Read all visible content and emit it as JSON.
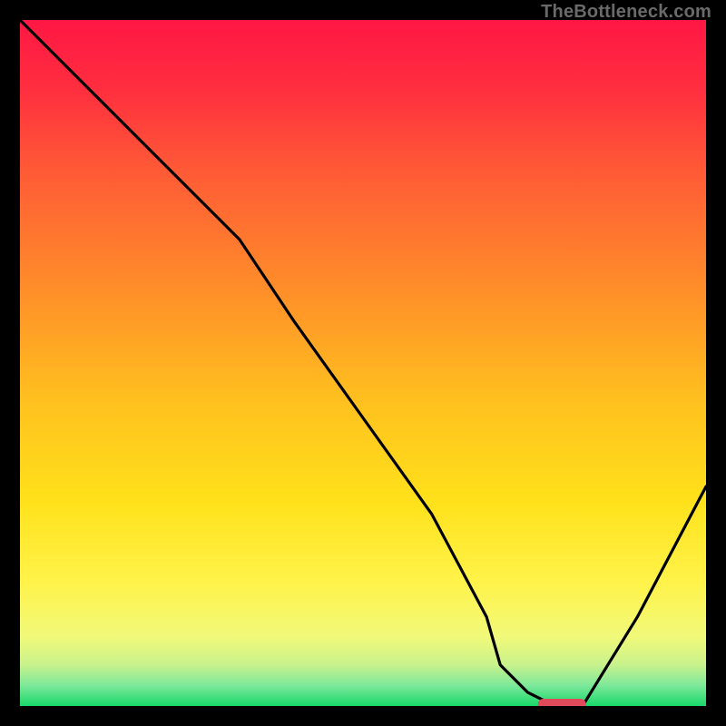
{
  "watermark": "TheBottleneck.com",
  "chart_data": {
    "type": "line",
    "title": "",
    "xlabel": "",
    "ylabel": "",
    "xlim": [
      0,
      100
    ],
    "ylim": [
      0,
      100
    ],
    "series": [
      {
        "name": "bottleneck-curve",
        "x": [
          0,
          10,
          20,
          30,
          32,
          40,
          50,
          60,
          68,
          70,
          74,
          78,
          82,
          90,
          100
        ],
        "y": [
          100,
          90,
          80,
          70,
          68,
          56,
          42,
          28,
          13,
          6,
          2,
          0,
          0,
          13,
          32
        ]
      }
    ],
    "marker": {
      "x_center": 79,
      "x_halfwidth": 3.5,
      "y": 0
    },
    "gradient_stops": [
      {
        "offset": 0.0,
        "color": "#ff1744"
      },
      {
        "offset": 0.1,
        "color": "#ff2e3f"
      },
      {
        "offset": 0.22,
        "color": "#ff5a36"
      },
      {
        "offset": 0.38,
        "color": "#ff8a2a"
      },
      {
        "offset": 0.55,
        "color": "#ffbf1f"
      },
      {
        "offset": 0.7,
        "color": "#ffe11a"
      },
      {
        "offset": 0.82,
        "color": "#fff34a"
      },
      {
        "offset": 0.9,
        "color": "#f1f97a"
      },
      {
        "offset": 0.94,
        "color": "#c8f28c"
      },
      {
        "offset": 0.97,
        "color": "#7de89a"
      },
      {
        "offset": 1.0,
        "color": "#18d86a"
      }
    ]
  }
}
